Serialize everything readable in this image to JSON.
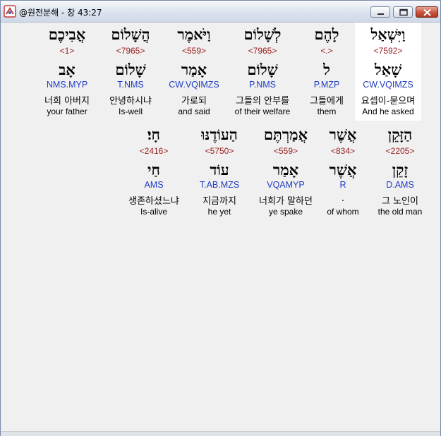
{
  "window": {
    "title": "@원전분해 - 창 43:27",
    "min_icon": "minimize-icon",
    "max_icon": "maximize-icon",
    "close_icon": "close-icon"
  },
  "rows": [
    {
      "words": [
        {
          "heb_top": "וַיִּשְׁאַל",
          "strong": "<7592>",
          "heb_bottom": "שָׁאַל",
          "parse": "CW.VQIMZS",
          "kor": "요셉이-묻으며",
          "eng": "And he asked",
          "selected": true
        },
        {
          "heb_top": "לָהֶם",
          "strong": "<.>",
          "heb_bottom": "ל",
          "parse": "P.MZP",
          "kor": "그들에게",
          "eng": "them"
        },
        {
          "heb_top": "לְשָׁלוֹם",
          "strong": "<7965>",
          "heb_bottom": "שָׁלוֹם",
          "parse": "P.NMS",
          "kor": "그들의 안부를",
          "eng": "of their welfare"
        },
        {
          "heb_top": "וַיֹּאמֶר",
          "strong": "<559>",
          "heb_bottom": "אָמַר",
          "parse": "CW.VQIMZS",
          "kor": "가로되",
          "eng": "and said"
        },
        {
          "heb_top": "הֲשָׁלוֹם",
          "strong": "<7965>",
          "heb_bottom": "שָׁלוֹם",
          "parse": "T.NMS",
          "kor": "안녕하시냐",
          "eng": "Is-well"
        },
        {
          "heb_top": "אֲבִיכֶם",
          "strong": "<1>",
          "heb_bottom": "אָב",
          "parse": "NMS.MYP",
          "kor": "너희 아버지",
          "eng": "your father"
        }
      ]
    },
    {
      "words": [
        {
          "heb_top": "הַזָּקֵן",
          "strong": "<2205>",
          "heb_bottom": "זָקֵן",
          "parse": "D.AMS",
          "kor": "그 노인이",
          "eng": "the old man"
        },
        {
          "heb_top": "אֲשֶׁר",
          "strong": "<834>",
          "heb_bottom": "אֲשֶׁר",
          "parse": "R",
          "kor": ".",
          "eng": "of whom"
        },
        {
          "heb_top": "אֲמַרְתֶּם",
          "strong": "<559>",
          "heb_bottom": "אָמַר",
          "parse": "VQAMYP",
          "kor": "너희가 말하던",
          "eng": "ye spake"
        },
        {
          "heb_top": "הַעוֹדֶנּוּ",
          "strong": "<5750>",
          "heb_bottom": "עוֹד",
          "parse": "T.AB.MZS",
          "kor": "지금까지",
          "eng": "he yet"
        },
        {
          "heb_top": "חָי׃",
          "strong": "<2416>",
          "heb_bottom": "חַי",
          "parse": "AMS",
          "kor": "생존하셨느냐",
          "eng": "Is-alive"
        }
      ]
    }
  ]
}
